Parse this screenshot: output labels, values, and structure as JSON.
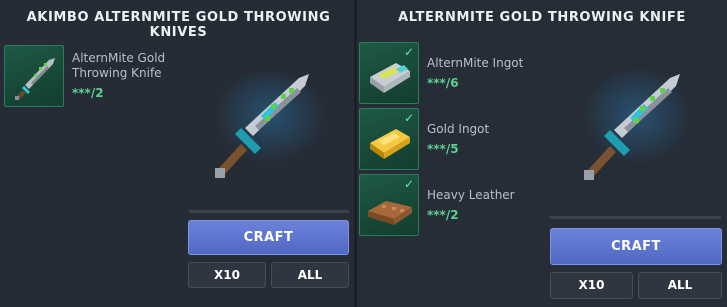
{
  "left_panel": {
    "title": "AKIMBO ALTERNMITE GOLD THROWING KNIVES",
    "ingredient": {
      "name_line1": "AlternMite Gold",
      "name_line2": "Throwing Knife",
      "count": "***/2",
      "icon": "knife-icon"
    },
    "craft_label": "CRAFT",
    "x10_label": "X10",
    "all_label": "ALL"
  },
  "right_panel": {
    "title": "ALTERNMITE GOLD THROWING KNIFE",
    "ingredients": [
      {
        "name": "AlternMite Ingot",
        "count": "***/6",
        "icon": "alternmite-ingot-icon",
        "checked": true
      },
      {
        "name": "Gold Ingot",
        "count": "***/5",
        "icon": "gold-ingot-icon",
        "checked": true
      },
      {
        "name": "Heavy Leather",
        "count": "***/2",
        "icon": "leather-icon",
        "checked": true
      }
    ],
    "craft_label": "CRAFT",
    "x10_label": "X10",
    "all_label": "ALL"
  },
  "colors": {
    "craft_button": "#5f76d0",
    "count_green": "#5cd18f",
    "slot_green": "#1e5a45"
  }
}
